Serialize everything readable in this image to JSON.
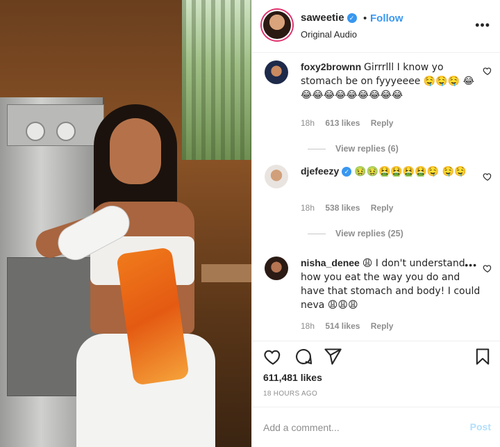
{
  "post": {
    "username": "saweetie",
    "follow_label": "Follow",
    "dot": "•",
    "audio": "Original Audio",
    "more": "•••"
  },
  "comments": [
    {
      "user": "foxy2brownn",
      "text": "Girrrlll I know yo stomach be on fyyyeeee 🤤🤤🤤 😂😂😂😂😂😂😂😂😂😂",
      "time": "18h",
      "likes": "613 likes",
      "reply": "Reply",
      "view_replies": "View replies (6)",
      "verified": false
    },
    {
      "user": "djefeezy",
      "text": "🤢🤢🤮🤮🤮🤮🤤 🤤🤤",
      "time": "18h",
      "likes": "538 likes",
      "reply": "Reply",
      "view_replies": "View replies (25)",
      "verified": true
    },
    {
      "user": "nisha_denee",
      "text": "😩 I don't understand how you eat the way you do and have that stomach and body! I could neva 😩😩😩",
      "time": "18h",
      "likes": "514 likes",
      "reply": "Reply",
      "more": "•••",
      "verified": false
    }
  ],
  "actions": {
    "likes": "611,481 likes",
    "time_ago": "18 HOURS AGO"
  },
  "add_comment": {
    "placeholder": "Add a comment...",
    "post_label": "Post"
  },
  "colors": {
    "accent_blue": "#3897f0",
    "muted_text": "#8e8e8e",
    "post_disabled": "#b2dffc"
  },
  "icons": {
    "more": "more-horizontal-icon",
    "heart": "heart-icon",
    "comment": "comment-icon",
    "share": "share-icon",
    "bookmark": "bookmark-icon",
    "verified": "verified-badge-icon"
  }
}
